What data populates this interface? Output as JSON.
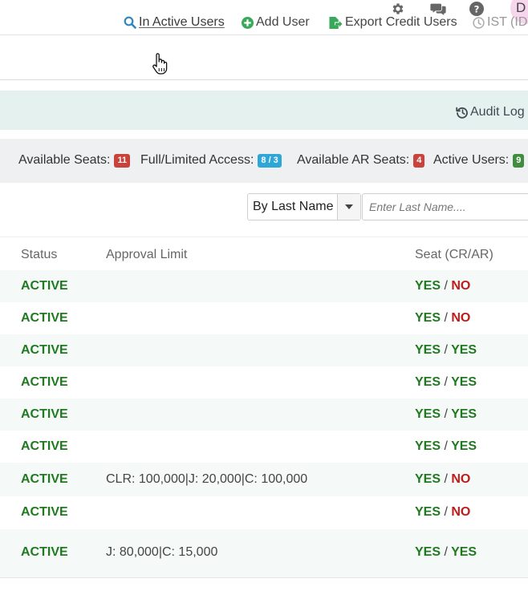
{
  "header": {
    "icons": [
      "gear-icon",
      "comments-icon",
      "help-icon"
    ],
    "avatar_initial": "D"
  },
  "actions": {
    "inactive_users": "In Active Users",
    "add_user": "Add User",
    "export_credit_users": "Export Credit Users",
    "timezone": "IST (IDT"
  },
  "audit": {
    "label": "Audit Log"
  },
  "stats": {
    "available_seats_label": "Available Seats:",
    "available_seats_value": "11",
    "full_limited_label": "Full/Limited Access:",
    "full_limited_value": "8 / 3",
    "available_ar_label": "Available AR Seats:",
    "available_ar_value": "4",
    "active_users_label": "Active Users:",
    "active_users_value": "9"
  },
  "filter": {
    "sort_selected": "By Last Name",
    "search_placeholder": "Enter Last Name...."
  },
  "table": {
    "columns": {
      "status": "Status",
      "approval_limit": "Approval Limit",
      "seat": "Seat (CR/AR)"
    },
    "separator": "/",
    "rows": [
      {
        "status": "ACTIVE",
        "approval_limit": "",
        "cr": "YES",
        "ar": "NO"
      },
      {
        "status": "ACTIVE",
        "approval_limit": "",
        "cr": "YES",
        "ar": "NO"
      },
      {
        "status": "ACTIVE",
        "approval_limit": "",
        "cr": "YES",
        "ar": "YES"
      },
      {
        "status": "ACTIVE",
        "approval_limit": "",
        "cr": "YES",
        "ar": "YES"
      },
      {
        "status": "ACTIVE",
        "approval_limit": "",
        "cr": "YES",
        "ar": "YES"
      },
      {
        "status": "ACTIVE",
        "approval_limit": "",
        "cr": "YES",
        "ar": "YES"
      },
      {
        "status": "ACTIVE",
        "approval_limit": "CLR: 100,000|J: 20,000|C: 100,000",
        "cr": "YES",
        "ar": "NO"
      },
      {
        "status": "ACTIVE",
        "approval_limit": "",
        "cr": "YES",
        "ar": "NO"
      },
      {
        "status": "ACTIVE",
        "approval_limit": "J: 80,000|C: 15,000",
        "cr": "YES",
        "ar": "YES"
      }
    ]
  },
  "colors": {
    "active_green": "#1f7a1f",
    "no_red": "#c21a1a",
    "link_blue": "#2e86c1",
    "add_green": "#3aa85a",
    "badge_red": "#c9423b",
    "badge_blue": "#2ea6d7",
    "badge_green": "#3e8e3e",
    "audit_band": "#e5f1ef",
    "stats_band": "#eef0f2"
  }
}
